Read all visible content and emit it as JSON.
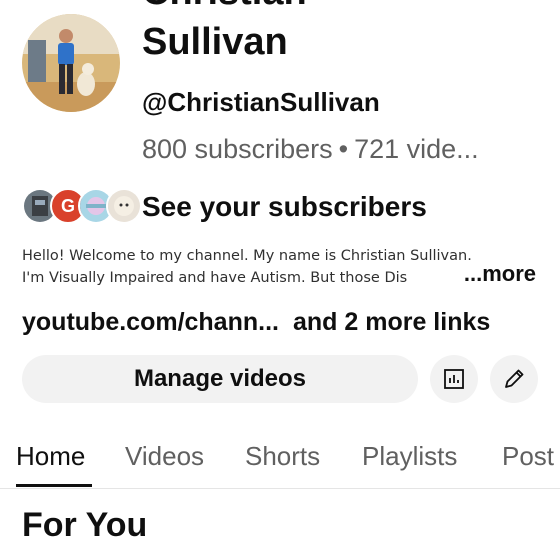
{
  "channel": {
    "name_line1": "Christian",
    "name_line2": "Sullivan",
    "handle": "@ChristianSullivan",
    "subscribers": "800 subscribers",
    "videos": "721 vide...",
    "separator": "•"
  },
  "subscribers_row": {
    "label": "See your subscribers",
    "avatar_letter": "G"
  },
  "description": {
    "line1": "Hello! Welcome to my channel. My name is Christian Sullivan.",
    "line2": "I'm Visually Impaired and have Autism. But those Dis",
    "more": "...more"
  },
  "links": {
    "primary": "youtube.com/chann...",
    "extra": "and 2 more links"
  },
  "actions": {
    "manage_videos": "Manage videos",
    "analytics_icon": "analytics-icon",
    "edit_icon": "pencil-icon"
  },
  "tabs": [
    "Home",
    "Videos",
    "Shorts",
    "Playlists",
    "Post"
  ],
  "active_tab": "Home",
  "section": {
    "title": "For You"
  }
}
